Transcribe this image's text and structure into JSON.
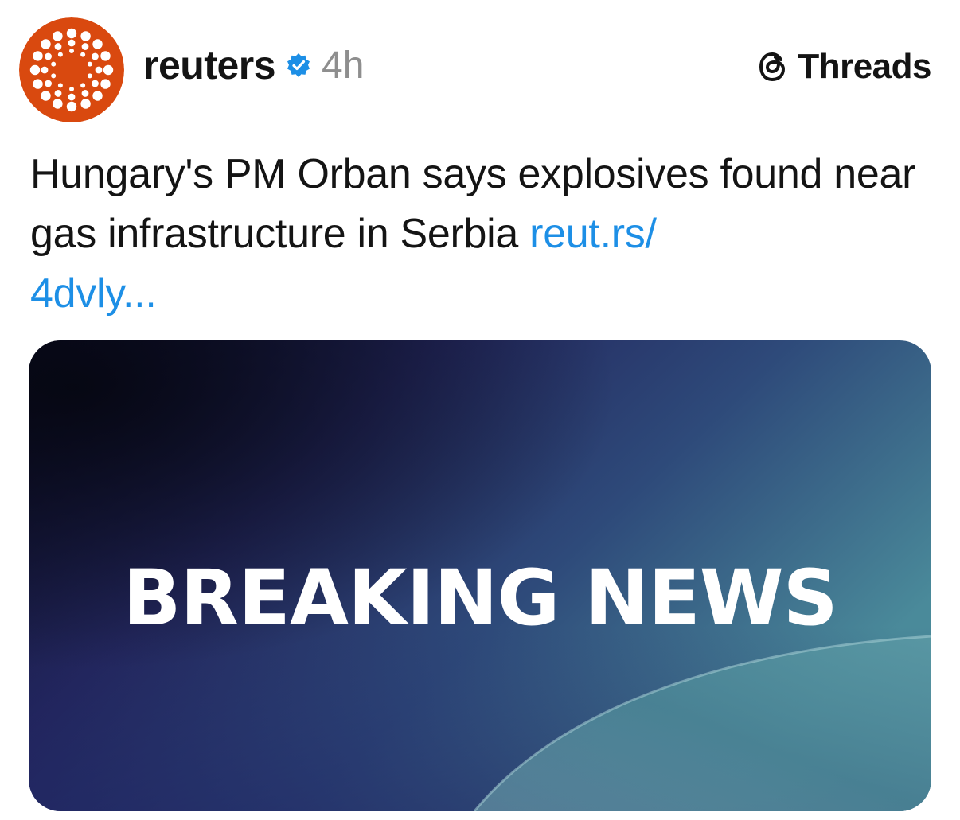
{
  "post": {
    "author": {
      "username": "reuters",
      "verified": true,
      "avatar_icon": "reuters-logo",
      "avatar_color": "#d9490f"
    },
    "timestamp": "4h",
    "platform": {
      "label": "Threads",
      "icon": "threads-logo-icon"
    },
    "caption": {
      "text": "Hungary's PM Orban says explosives found near gas infrastructure in Serbia ",
      "link": "reut.rs/\n4dvly..."
    },
    "media": {
      "headline": "BREAKING NEWS",
      "colors": {
        "dark": "#0c0d2a",
        "mid": "#2b2f6e",
        "teal": "#3e8496",
        "link": "#1d8fe6"
      }
    }
  }
}
